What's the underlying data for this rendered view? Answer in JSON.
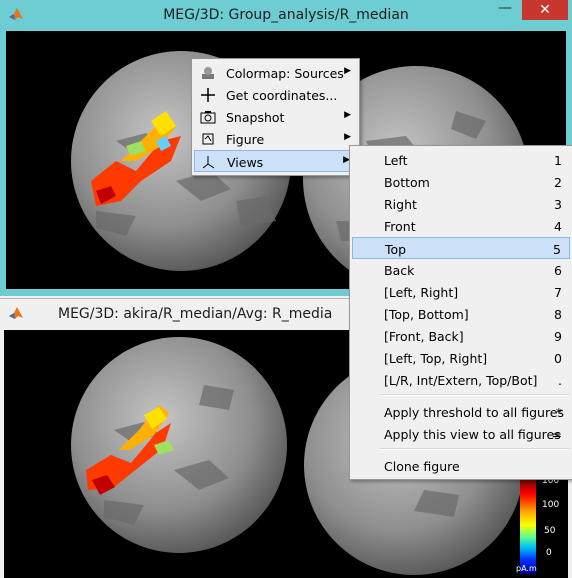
{
  "windows": [
    {
      "title": "MEG/3D: Group_analysis/R_median",
      "minimize": "—",
      "close": "✕"
    },
    {
      "title": "MEG/3D: akira/R_median/Avg: R_media"
    }
  ],
  "context_menu": {
    "items": [
      {
        "label": "Colormap: Sources",
        "submenu": true,
        "icon": "colormap-icon"
      },
      {
        "label": "Get coordinates...",
        "submenu": false,
        "icon": "crosshair-icon"
      },
      {
        "label": "Snapshot",
        "submenu": true,
        "icon": "camera-icon"
      },
      {
        "label": "Figure",
        "submenu": true,
        "icon": "figure-icon"
      },
      {
        "label": "Views",
        "submenu": true,
        "icon": "axes-icon",
        "highlighted": true
      }
    ]
  },
  "views_menu": {
    "items": [
      {
        "label": "Left",
        "shortcut": "1"
      },
      {
        "label": "Bottom",
        "shortcut": "2"
      },
      {
        "label": "Right",
        "shortcut": "3"
      },
      {
        "label": "Front",
        "shortcut": "4"
      },
      {
        "label": "Top",
        "shortcut": "5",
        "highlighted": true
      },
      {
        "label": "Back",
        "shortcut": "6"
      },
      {
        "label": "[Left, Right]",
        "shortcut": "7"
      },
      {
        "label": "[Top, Bottom]",
        "shortcut": "8"
      },
      {
        "label": "[Front, Back]",
        "shortcut": "9"
      },
      {
        "label": "[Left, Top, Right]",
        "shortcut": "0"
      },
      {
        "label": "[L/R, Int/Extern, Top/Bot]",
        "shortcut": "."
      },
      {
        "label": "Apply threshold to all figures",
        "shortcut": "*"
      },
      {
        "label": "Apply this view to all figures",
        "shortcut": "="
      },
      {
        "label": "Clone figure",
        "shortcut": ""
      }
    ]
  },
  "colorbar": {
    "ticks": [
      "100",
      "50",
      "0"
    ],
    "top_tick_partial": "100",
    "unit": "pA.m",
    "colors": [
      "#7a0000",
      "#ff0000",
      "#ffb000",
      "#ffff00",
      "#60ff80",
      "#00c0ff",
      "#0030ff",
      "#00008c"
    ]
  }
}
